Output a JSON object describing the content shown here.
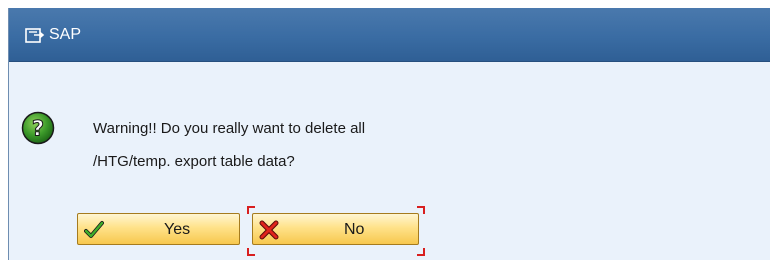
{
  "window": {
    "title": "SAP",
    "title_icon": "dialog-icon"
  },
  "message": {
    "icon": "question-icon",
    "line1": "Warning!! Do you really want to delete all",
    "line2": "/HTG/temp. export table data?"
  },
  "buttons": {
    "yes": {
      "label": "Yes",
      "icon": "checkmark-icon"
    },
    "no": {
      "label": "No",
      "icon": "cross-icon",
      "focused": true
    }
  },
  "colors": {
    "titlebar": "#3a6ca3",
    "dialog_background": "#eaf2fb",
    "button_gradient_top": "#fff6d2",
    "button_gradient_bottom": "#f7c84e",
    "focus_indicator": "#d81f1f",
    "question_icon": "#2e8b2e"
  }
}
